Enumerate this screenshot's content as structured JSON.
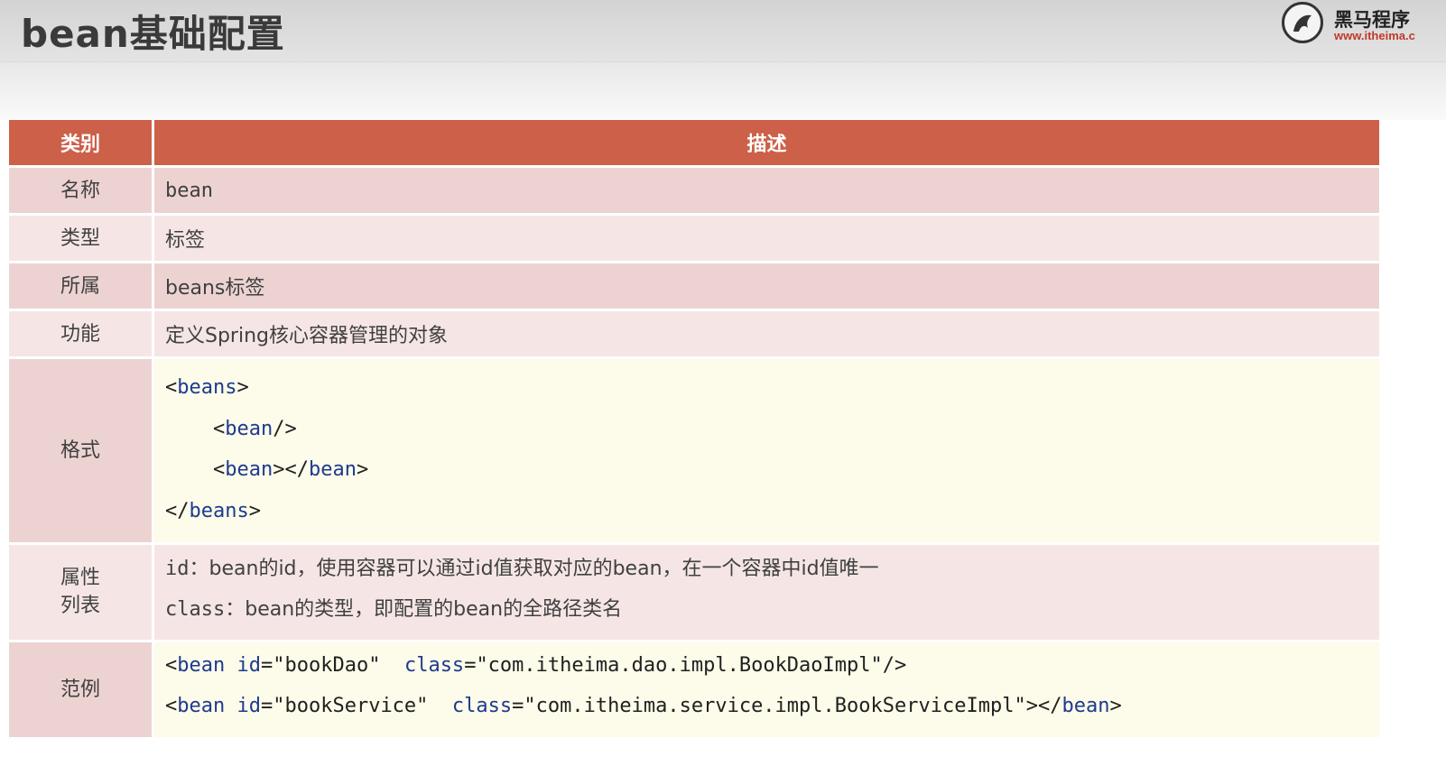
{
  "header": {
    "title": "bean基础配置",
    "logo_text": "黑马程序",
    "logo_url": "www.itheima.c"
  },
  "table": {
    "headers": [
      "类别",
      "描述"
    ],
    "rows": [
      {
        "category": "名称",
        "description": "bean"
      },
      {
        "category": "类型",
        "description": "标签"
      },
      {
        "category": "所属",
        "description": "beans标签"
      },
      {
        "category": "功能",
        "description": "定义Spring核心容器管理的对象"
      }
    ],
    "format": {
      "category": "格式",
      "lines": [
        {
          "indent": "",
          "open": "<",
          "tag": "beans",
          "close": ">"
        },
        {
          "indent": "    ",
          "open": "<",
          "tag": "bean",
          "close": "/>"
        },
        {
          "indent": "    ",
          "open": "<",
          "tag": "bean",
          "close": "></",
          "tag2": "bean",
          "close2": ">"
        },
        {
          "indent": "",
          "open": "</",
          "tag": "beans",
          "close": ">"
        }
      ]
    },
    "attributes": {
      "category_line1": "属性",
      "category_line2": "列表",
      "lines": [
        {
          "name": "id",
          "sep": "：",
          "text": "bean的id，使用容器可以通过id值获取对应的bean，在一个容器中id值唯一"
        },
        {
          "name": "class",
          "sep": "：",
          "text": "bean的类型，即配置的bean的全路径类名"
        }
      ]
    },
    "example": {
      "category": "范例",
      "lines": [
        {
          "p1": "<",
          "tag": "bean",
          "sp1": " ",
          "a1": "id",
          "eq1": "=",
          "v1": "\"bookDao\"",
          "sp2": "  ",
          "a2": "class",
          "eq2": "=",
          "v2": "\"com.itheima.dao.impl.BookDaoImpl\"",
          "end": "/>",
          "end_tag": "",
          "end_close": ""
        },
        {
          "p1": "<",
          "tag": "bean",
          "sp1": " ",
          "a1": "id",
          "eq1": "=",
          "v1": "\"bookService\"",
          "sp2": "  ",
          "a2": "class",
          "eq2": "=",
          "v2": "\"com.itheima.service.impl.BookServiceImpl\"",
          "end": "></",
          "end_tag": "bean",
          "end_close": ">"
        }
      ]
    }
  },
  "colors": {
    "header_bg": "#cc6048",
    "row_dark": "#ecd3d1",
    "row_light": "#f5e6e5",
    "code_bg": "#fdfbe9",
    "keyword": "#1d3b8f"
  }
}
